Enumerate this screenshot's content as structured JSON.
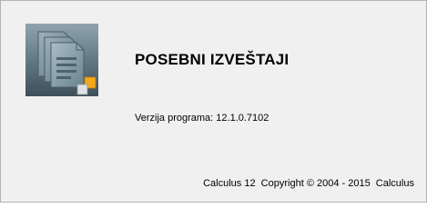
{
  "window": {
    "title": "POSEBNI IZVEŠTAJI",
    "logo_icon": "stacked-documents-icon"
  },
  "version": {
    "label": "Verzija programa:",
    "value": "12.1.0.7102"
  },
  "footer": {
    "copyright": "Calculus 12  Copyright © 2004 - 2015  Calculus"
  },
  "colors": {
    "panel_background": "#f0f0f0",
    "panel_border": "#b4b4b4",
    "logo_dark": "#3e4f58",
    "logo_light": "#7e949e",
    "accent_orange": "#f5a81e"
  }
}
